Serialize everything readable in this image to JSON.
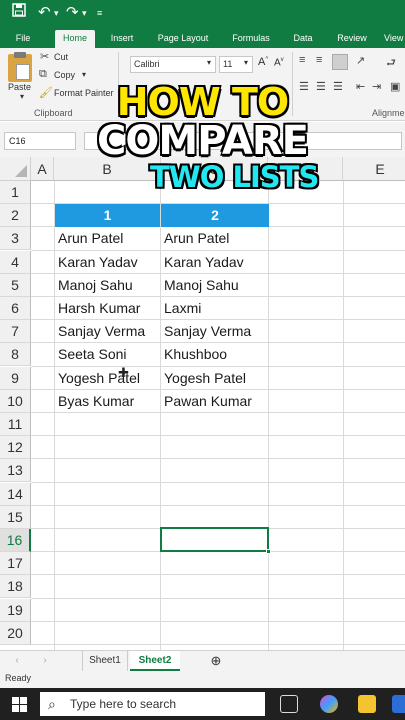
{
  "quick_access": {
    "save_icon": "save-icon",
    "undo_icon": "undo-icon",
    "redo_icon": "redo-icon"
  },
  "ribbon_tabs": [
    {
      "label": "File"
    },
    {
      "label": "Home"
    },
    {
      "label": "Insert"
    },
    {
      "label": "Page Layout"
    },
    {
      "label": "Formulas"
    },
    {
      "label": "Data"
    },
    {
      "label": "Review"
    },
    {
      "label": "View"
    }
  ],
  "ribbon": {
    "paste_label": "Paste",
    "cut_label": "Cut",
    "copy_label": "Copy",
    "format_painter_label": "Format Painter",
    "clipboard_group": "Clipboard",
    "font_name": "Calibri",
    "font_size": "11",
    "alignment_group": "Alignment"
  },
  "formula_bar": {
    "name_box": "C16",
    "formula": ""
  },
  "columns": [
    "A",
    "B",
    "C",
    "D",
    "E"
  ],
  "rows": [
    "1",
    "2",
    "3",
    "4",
    "5",
    "6",
    "7",
    "8",
    "9",
    "10",
    "11",
    "12",
    "13",
    "14",
    "15",
    "16",
    "17",
    "18",
    "19",
    "20"
  ],
  "selected_row": "16",
  "table": {
    "header_1": "1",
    "header_2": "2",
    "list1": [
      "Arun Patel",
      "Karan Yadav",
      "Manoj Sahu",
      "Harsh Kumar",
      "Sanjay Verma",
      "Seeta Soni",
      "Yogesh Patel",
      "Byas Kumar"
    ],
    "list2": [
      "Arun Patel",
      "Karan Yadav",
      "Manoj Sahu",
      "Laxmi",
      "Sanjay Verma",
      "Khushboo",
      "Yogesh Patel",
      "Pawan Kumar"
    ]
  },
  "overlay": {
    "line1": "HOW TO",
    "line2": "COMPARE",
    "line3": "TWO LISTS"
  },
  "sheets": [
    {
      "label": "Sheet1",
      "active": false
    },
    {
      "label": "Sheet2",
      "active": true
    }
  ],
  "status": "Ready",
  "taskbar": {
    "search_placeholder": "Type here to search"
  },
  "colors": {
    "excel_green": "#107c41",
    "header_blue": "#1f9ae0",
    "overlay_yellow": "#ffe600",
    "overlay_cyan": "#22e6f0"
  }
}
